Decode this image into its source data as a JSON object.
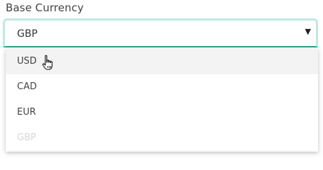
{
  "field": {
    "label": "Base Currency",
    "selected": "GBP"
  },
  "icons": {
    "caret": "caret-down-icon",
    "cursor": "hand-pointer-icon"
  },
  "dropdown": {
    "options": [
      {
        "label": "USD",
        "state": "hover"
      },
      {
        "label": "CAD",
        "state": "normal"
      },
      {
        "label": "EUR",
        "state": "normal"
      },
      {
        "label": "GBP",
        "state": "disabled"
      }
    ]
  },
  "colors": {
    "accent": "#2aa38c",
    "focus_ring": "#bfe9e1",
    "hover_bg": "#f3f3f3",
    "disabled_text": "#d6d6d6"
  }
}
